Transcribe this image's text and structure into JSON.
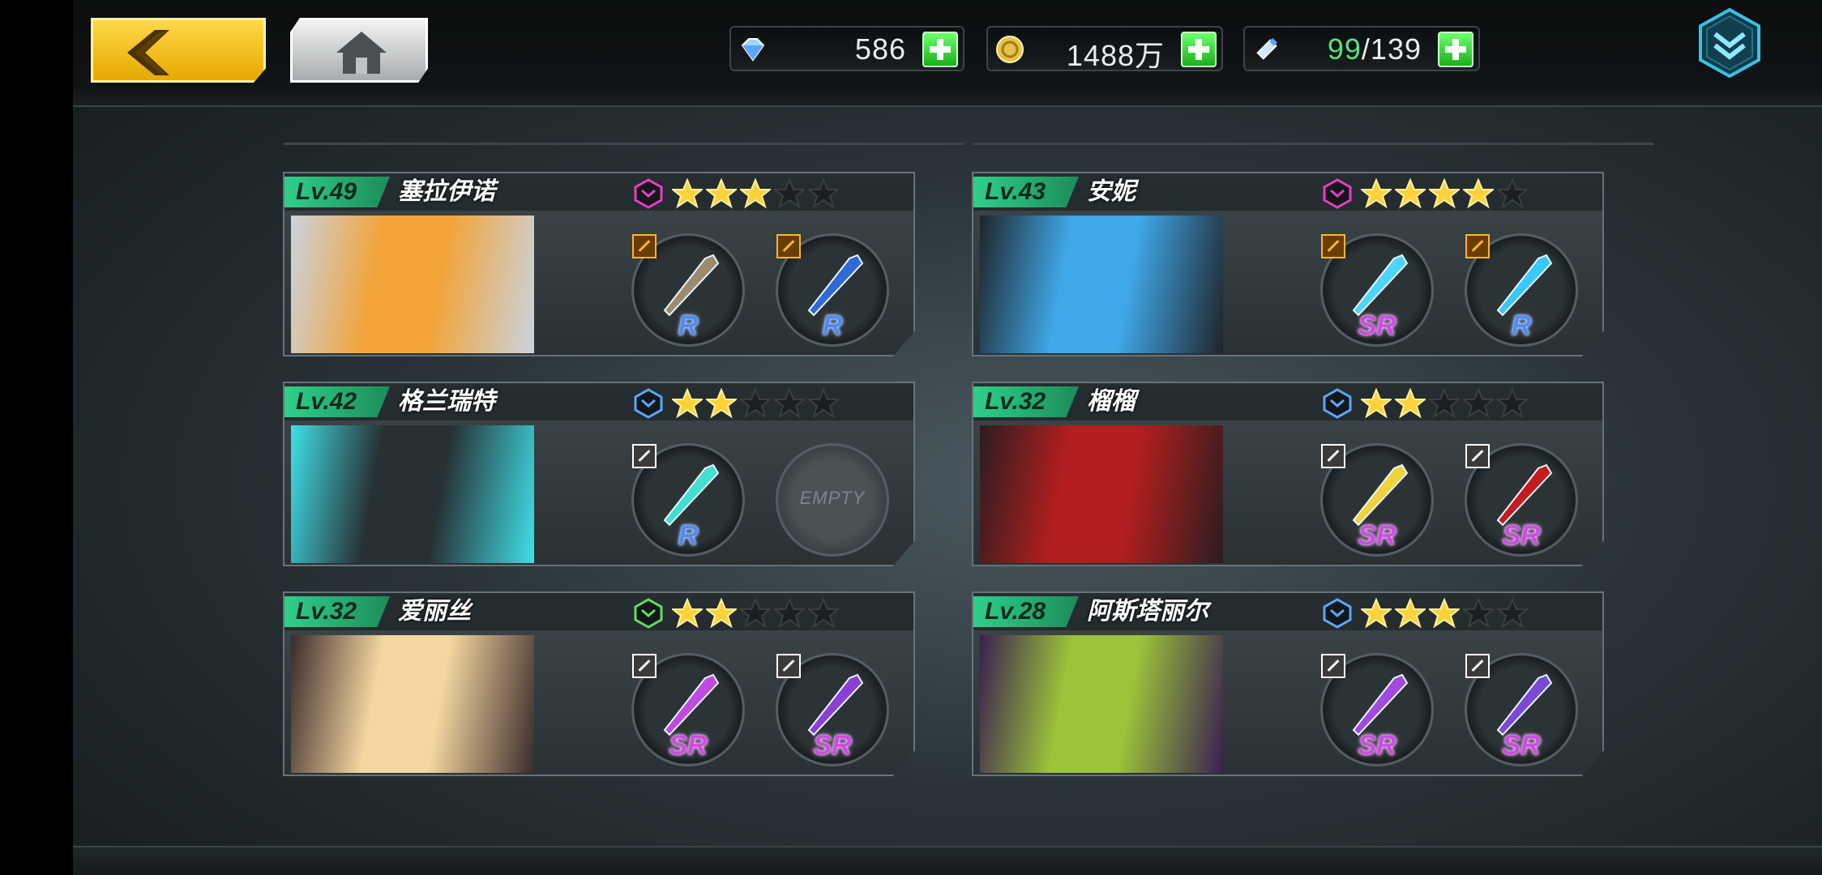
{
  "topbar": {
    "back_label": "",
    "home_label": "",
    "resources": [
      {
        "name": "diamond",
        "icon": "diamond-icon",
        "value": "586"
      },
      {
        "name": "gold",
        "icon": "gold-coin-icon",
        "value": "1488万"
      },
      {
        "name": "stamina",
        "icon": "syringe-icon",
        "current": "99",
        "separator": "/",
        "max": "139"
      }
    ]
  },
  "characters": [
    {
      "level": "Lv.49",
      "name": "塞拉伊诺",
      "class_color": "#e63fc6",
      "stars": 3,
      "max_stars": 5,
      "portrait_colors": [
        "#f2a43a",
        "#c9d4e0"
      ],
      "slots": [
        {
          "rarity": "R",
          "tag": "orange",
          "weapon_color": "#9b8c6e"
        },
        {
          "rarity": "R",
          "tag": "orange",
          "weapon_color": "#2f6ad8"
        }
      ]
    },
    {
      "level": "Lv.43",
      "name": "安妮",
      "class_color": "#e63fc6",
      "stars": 4,
      "max_stars": 5,
      "portrait_colors": [
        "#3fa8e8",
        "#20242a"
      ],
      "slots": [
        {
          "rarity": "SR",
          "tag": "orange",
          "weapon_color": "#4ad6ff"
        },
        {
          "rarity": "R",
          "tag": "orange",
          "weapon_color": "#39c8ff"
        }
      ]
    },
    {
      "level": "Lv.42",
      "name": "格兰瑞特",
      "class_color": "#5aa8ff",
      "stars": 2,
      "max_stars": 5,
      "portrait_colors": [
        "#273033",
        "#3fe0e8"
      ],
      "slots": [
        {
          "rarity": "R",
          "tag": "white",
          "weapon_color": "#3fe0d0"
        },
        {
          "empty": true,
          "label": "EMPTY"
        }
      ]
    },
    {
      "level": "Lv.32",
      "name": "榴榴",
      "class_color": "#5aa8ff",
      "stars": 2,
      "max_stars": 5,
      "portrait_colors": [
        "#b51e1e",
        "#2b1d20"
      ],
      "slots": [
        {
          "rarity": "SR",
          "tag": "white",
          "weapon_color": "#f2d23a"
        },
        {
          "rarity": "SR",
          "tag": "white",
          "weapon_color": "#c41c1c"
        }
      ]
    },
    {
      "level": "Lv.32",
      "name": "爱丽丝",
      "class_color": "#5de05a",
      "stars": 2,
      "max_stars": 5,
      "portrait_colors": [
        "#f3d6a0",
        "#3a2b2b"
      ],
      "slots": [
        {
          "rarity": "SR",
          "tag": "white",
          "weapon_color": "#c04ae0"
        },
        {
          "rarity": "SR",
          "tag": "white",
          "weapon_color": "#8a3fd6"
        }
      ]
    },
    {
      "level": "Lv.28",
      "name": "阿斯塔丽尔",
      "class_color": "#5aa8ff",
      "stars": 3,
      "max_stars": 5,
      "portrait_colors": [
        "#9bc43a",
        "#3a1f4f"
      ],
      "slots": [
        {
          "rarity": "SR",
          "tag": "white",
          "weapon_color": "#a04ae0"
        },
        {
          "rarity": "SR",
          "tag": "white",
          "weapon_color": "#7a4ad6"
        }
      ]
    }
  ]
}
